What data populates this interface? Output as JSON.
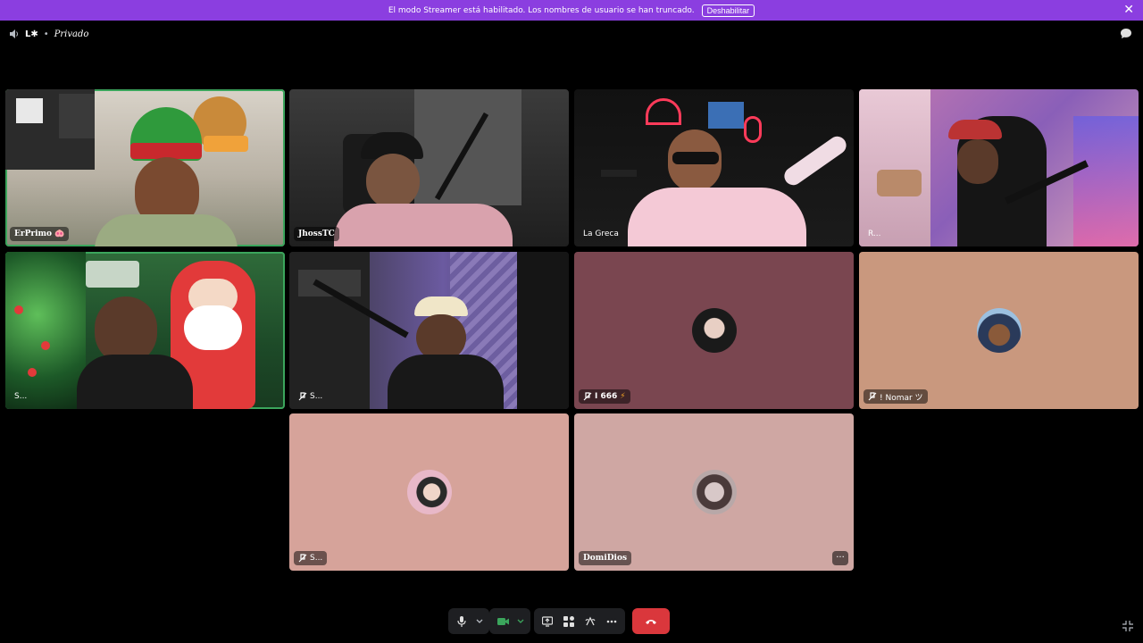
{
  "banner": {
    "text": "El modo Streamer está habilitado. Los nombres de usuario se han truncado.",
    "button": "Deshabilitar",
    "close": "✕"
  },
  "header": {
    "server": "L✱",
    "separator": "•",
    "channel": "Privado"
  },
  "tiles": [
    {
      "name": "ErPrimo",
      "badge": "🐽"
    },
    {
      "name": "JhossTC"
    },
    {
      "name": "La Greca"
    },
    {
      "name": "R..."
    },
    {
      "name": "S..."
    },
    {
      "name": "S..."
    },
    {
      "name": "I 666",
      "badge": "⚡"
    },
    {
      "name": "! Nomar ツ"
    },
    {
      "name": "S..."
    },
    {
      "name": "DomiDios",
      "more": "···"
    }
  ],
  "colors": {
    "banner": "#8b3ee0",
    "speaking_border": "#3ba55c",
    "tile_muted_rose": "#7a4650",
    "tile_beige": "#c9987e",
    "tile_pink": "#d6a39a",
    "tile_pink2": "#cfa7a3",
    "hangup": "#da373c",
    "camera_on": "#3ba55c"
  },
  "icons": [
    "speaker-icon",
    "chat-icon",
    "mic-icon",
    "camera-icon",
    "screen-share-icon",
    "activities-icon",
    "soundboard-icon",
    "more-icon",
    "hangup-icon",
    "fullscreen-icon",
    "mute-icon"
  ]
}
